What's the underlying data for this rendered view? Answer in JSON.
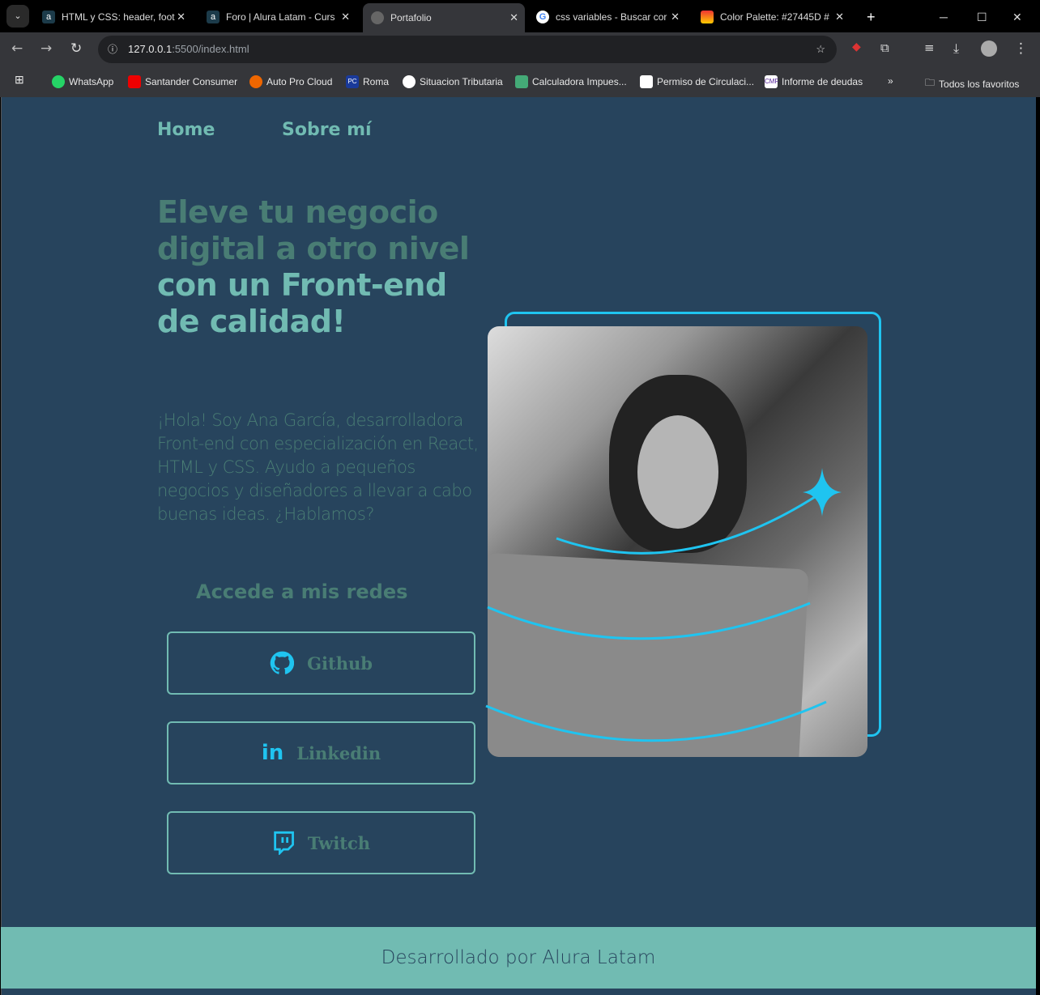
{
  "browser": {
    "tabs": [
      {
        "title": "HTML y CSS: header, foot",
        "icon": "alura-icon"
      },
      {
        "title": "Foro | Alura Latam - Curs",
        "icon": "alura-icon"
      },
      {
        "title": "Portafolio",
        "icon": "globe-icon",
        "active": true
      },
      {
        "title": "css variables - Buscar cor",
        "icon": "google-icon"
      },
      {
        "title": "Color Palette: #27445D #",
        "icon": "palette-icon"
      }
    ],
    "url_host": "127.0.0.1",
    "url_rest": ":5500/index.html",
    "bookmarks": [
      "WhatsApp",
      "Santander Consumer",
      "Auto Pro Cloud",
      "Roma",
      "Situacion Tributaria",
      "Calculadora Impues...",
      "Permiso de Circulaci...",
      "Informe de deudas"
    ],
    "all_bookmarks": "Todos los favoritos"
  },
  "nav": {
    "home": "Home",
    "about": "Sobre mí"
  },
  "hero": {
    "part1": "Eleve tu negocio digital a otro nivel",
    "part2": "con un Front-end de calidad!"
  },
  "intro": "¡Hola! Soy Ana García, desarrolladora Front-end con especialización en React, HTML y CSS. Ayudo a pequeños negocios y diseñadores a llevar a cabo buenas ideas. ¿Hablamos?",
  "social": {
    "title": "Accede a mis redes",
    "buttons": [
      {
        "label": "Github",
        "icon": "github-icon"
      },
      {
        "label": "Linkedin",
        "icon": "linkedin-icon"
      },
      {
        "label": "Twitch",
        "icon": "twitch-icon"
      }
    ]
  },
  "footer": "Desarrollado por Alura Latam",
  "colors": {
    "background": "#27445D",
    "primary": "#71BBB2",
    "secondary": "#497D74",
    "accent": "#1FC4F0"
  }
}
